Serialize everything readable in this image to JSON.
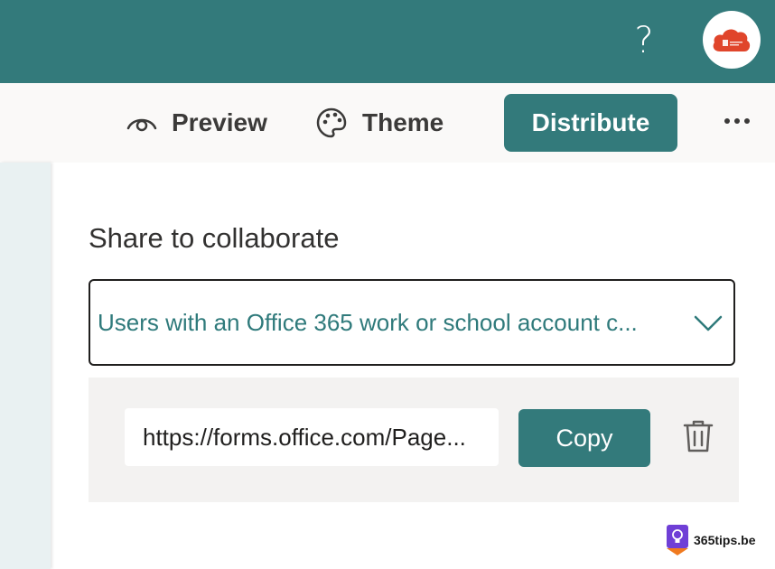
{
  "header": {
    "help_icon": "question-mark-icon",
    "help_glyph": "?",
    "avatar_icon": "office365-cloud-logo"
  },
  "toolbar": {
    "preview_label": "Preview",
    "theme_label": "Theme",
    "distribute_label": "Distribute",
    "more_icon": "ellipsis-icon"
  },
  "share": {
    "title": "Share to collaborate",
    "permission_value": "Users with an Office 365 work or school account c...",
    "link_value": "https://forms.office.com/Page...",
    "copy_label": "Copy",
    "delete_icon": "trash-icon"
  },
  "watermark": {
    "text": "365tips.be"
  },
  "colors": {
    "brand": "#337a7b",
    "permission_text": "#2f7a7b",
    "toolbar_bg": "#faf9f8",
    "panel_bg": "#f3f2f1"
  }
}
